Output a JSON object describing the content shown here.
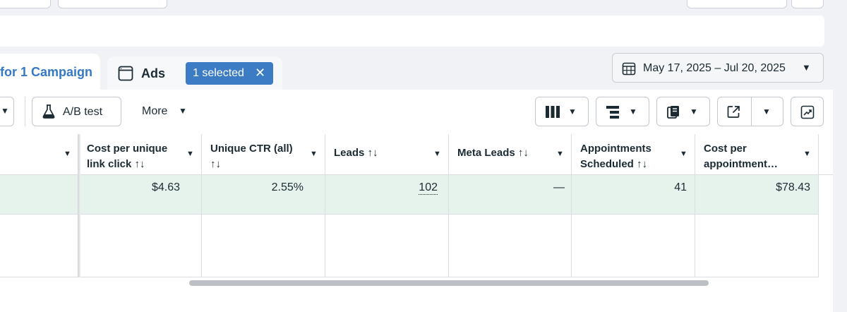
{
  "tabs": {
    "campaign_label": "for 1 Campaign",
    "ads_label": "Ads",
    "selected_label": "1 selected",
    "selected_close": "✕"
  },
  "date_range": {
    "label": "May 17, 2025 – Jul 20, 2025"
  },
  "toolbar": {
    "ab_test_label": "A/B test",
    "more_label": "More"
  },
  "table": {
    "columns": [
      {
        "line1": "Cost per unique",
        "line2": "link click ↑↓"
      },
      {
        "line1": "Unique CTR (all)",
        "line2": "↑↓"
      },
      {
        "line1": "Leads ↑↓",
        "line2": ""
      },
      {
        "line1": "Meta Leads ↑↓",
        "line2": ""
      },
      {
        "line1": "Appointments",
        "line2": "Scheduled ↑↓"
      },
      {
        "line1": "Cost per",
        "line2": "appointment…"
      }
    ],
    "row": [
      "$4.63",
      "2.55%",
      "102",
      "—",
      "41",
      "$78.43"
    ]
  },
  "colors": {
    "accent": "#3b7cc4",
    "row_highlight": "#e6f3ed"
  }
}
